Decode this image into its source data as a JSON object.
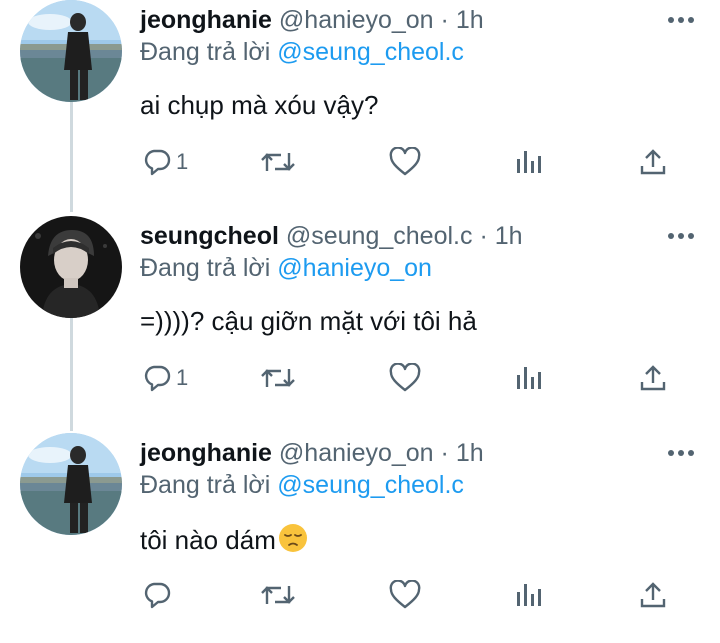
{
  "tweets": [
    {
      "name": "jeonghanie",
      "handle": "@hanieyo_on",
      "separator": "·",
      "time": "1h",
      "replying_prefix": "Đang trả lời",
      "replying_to": "@seung_cheol.c",
      "text": "ai chụp mà xóu vậy?",
      "reply_count": "1",
      "avatar": "lakeside-photo-avatar"
    },
    {
      "name": "seungcheol",
      "handle": "@seung_cheol.c",
      "separator": "·",
      "time": "1h",
      "replying_prefix": "Đang trả lời",
      "replying_to": "@hanieyo_on",
      "text": "=))))? cậu giỡn mặt với tôi hả",
      "reply_count": "1",
      "avatar": "dark-portrait-avatar"
    },
    {
      "name": "jeonghanie",
      "handle": "@hanieyo_on",
      "separator": "·",
      "time": "1h",
      "replying_prefix": "Đang trả lời",
      "replying_to": "@seung_cheol.c",
      "text": "tôi nào dám",
      "reply_count": "",
      "emoji": "pensive-face-emoji",
      "avatar": "lakeside-photo-avatar"
    }
  ],
  "icons": {
    "more": "more-horizontal-icon",
    "reply": "reply-bubble-icon",
    "retweet": "retweet-icon",
    "like": "heart-icon",
    "views": "analytics-bars-icon",
    "share": "share-upload-icon"
  },
  "colors": {
    "text": "#0f1419",
    "secondary": "#536471",
    "link": "#1d9bf0",
    "thread_line": "#cfd9de"
  }
}
